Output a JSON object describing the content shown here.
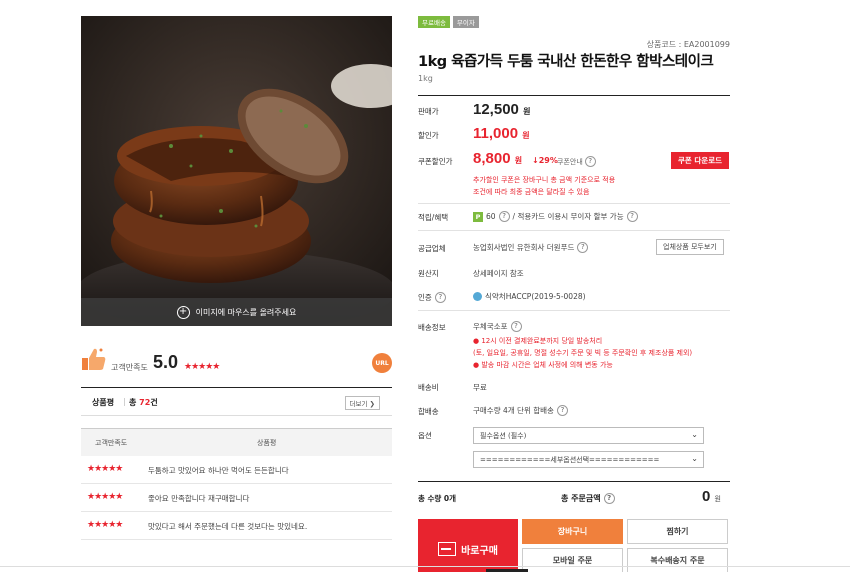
{
  "product_image": {
    "overlay_text": "이미지에 마우스를 올려주세요",
    "icon": "zoom-in-icon"
  },
  "satisfaction": {
    "label": "고객만족도",
    "score": "5.0",
    "stars": "★★★★★",
    "url_label": "URL",
    "colors": {
      "star": "#e8242f",
      "url_badge": "#f0803c"
    }
  },
  "reviews": {
    "title": "상품평",
    "count_prefix": "총",
    "count": "72",
    "count_suffix": "건",
    "more_label": "더보기 ❯",
    "columns": [
      "고객만족도",
      "상품평"
    ],
    "rows": [
      {
        "stars": "★★★★★",
        "text": "두툼하고 맛있어요 하나만 먹어도 든든합니다"
      },
      {
        "stars": "★★★★★",
        "text": "좋아요 만족합니다 재구매합니다"
      },
      {
        "stars": "★★★★★",
        "text": "맛있다고 해서 주문했는데 다른 것보다는 맛있네요."
      }
    ]
  },
  "product": {
    "badges": [
      "무료배송",
      "무이자"
    ],
    "code": "상품코드 : EA2001099",
    "title": "1kg 육즙가득 두툼 국내산 한돈한우 함박스테이크",
    "weight": "1kg"
  },
  "pricing": {
    "sale_label": "판매가",
    "sale_price": "12,500",
    "discount_label": "할인가",
    "discount_price": "11,000",
    "coupon_label": "쿠폰할인가",
    "coupon_price": "8,800",
    "currency": "원",
    "discount_rate": "↓29%",
    "coupon_info": "쿠폰안내",
    "coupon_button": "쿠폰 다운로드",
    "coupon_note_1": "추가할인 쿠폰은 장바구니 총 금액 기준으로 적용",
    "coupon_note_2": "조건에 따라 최종 금액은 달라질 수 있음",
    "colors": {
      "accent": "#e8242f"
    }
  },
  "info": {
    "benefit_label": "적립/혜택",
    "points_icon": "P",
    "points_value": "60",
    "card_text": "/ 적용카드 이용시 무이자 할부 가능",
    "supplier_label": "공급업체",
    "supplier_value": "농업회사법인 유한회사 더원푸드",
    "supplier_button": "업체상품 모두보기",
    "origin_label": "원산지",
    "origin_value": "상세페이지 참조",
    "cert_label": "인증",
    "cert_value": "식약처HACCP(2019-5-0028)",
    "shipping_label": "배송정보",
    "shipping_value": "우체국소포",
    "shipping_note_1": "● 12시 이전 결제완료분까지 당일 발송처리",
    "shipping_note_2": "(토, 일요일, 공휴일, 명절 성수기 주문 및 빅 등 주문확인 후 제조상품 제외)",
    "shipping_note_3": "● 발송 마감 시간은 업체 사정에 의해 변동 가능",
    "fee_label": "배송비",
    "fee_value": "무료",
    "bundle_label": "합배송",
    "bundle_value": "구매수량 4개 단위 합배송",
    "option_label": "옵션",
    "option_select_1": "필수옵션 (필수)",
    "option_select_2": "============세부옵션선택============"
  },
  "totals": {
    "qty_label": "총 수량 0개",
    "amount_label": "총 주문금액",
    "amount_value": "0",
    "amount_unit": "원"
  },
  "actions": {
    "buy_now": "바로구매",
    "cart": "장바구니",
    "wishlist": "찜하기",
    "mobile_order": "모바일 주문",
    "multi_ship": "복수배송지 주문"
  }
}
